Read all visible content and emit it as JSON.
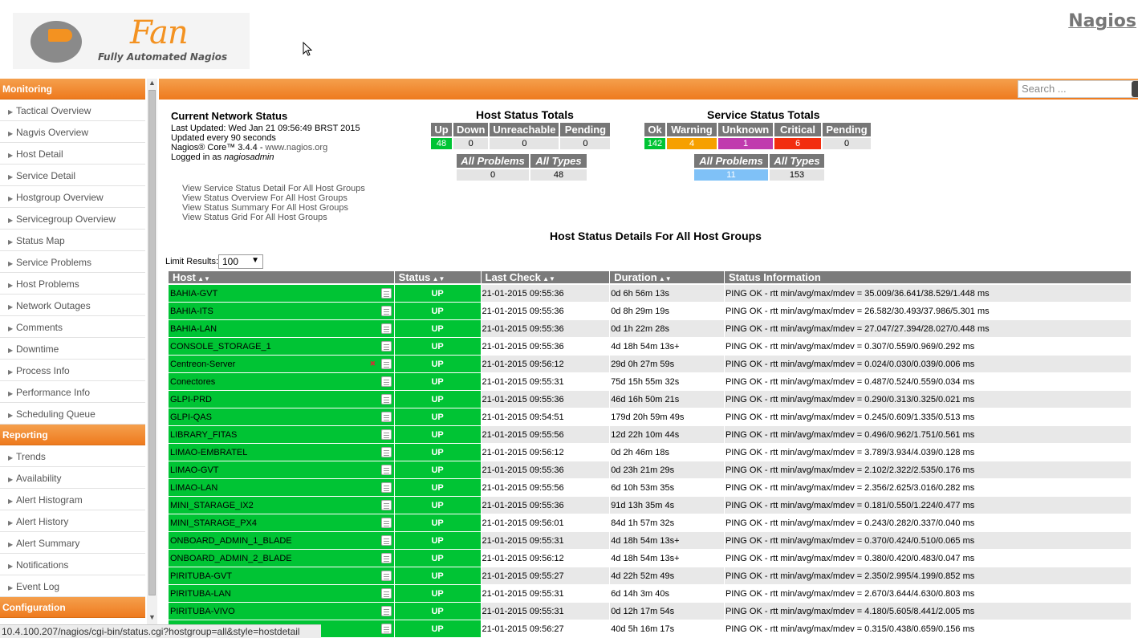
{
  "header": {
    "logo_text": "Fan",
    "logo_subtitle": "Fully Automated Nagios",
    "brand": "Nagios"
  },
  "search": {
    "placeholder": "Search ..."
  },
  "sidebar": {
    "sections": [
      {
        "title": "Monitoring",
        "items": [
          "Tactical Overview",
          "Nagvis Overview",
          "Host Detail",
          "Service Detail",
          "Hostgroup Overview",
          "Servicegroup Overview",
          "Status Map",
          "Service Problems",
          "Host Problems",
          "Network Outages",
          "Comments",
          "Downtime",
          "Process Info",
          "Performance Info",
          "Scheduling Queue"
        ]
      },
      {
        "title": "Reporting",
        "items": [
          "Trends",
          "Availability",
          "Alert Histogram",
          "Alert History",
          "Alert Summary",
          "Notifications",
          "Event Log"
        ]
      },
      {
        "title": "Configuration",
        "items": []
      }
    ]
  },
  "status": {
    "title": "Current Network Status",
    "last_updated": "Last Updated: Wed Jan 21 09:56:49 BRST 2015",
    "update_interval": "Updated every 90 seconds",
    "version_prefix": "Nagios® Core™ 3.4.4 - ",
    "version_link": "www.nagios.org",
    "logged_prefix": "Logged in as ",
    "user": "nagiosadmin"
  },
  "host_totals": {
    "title": "Host Status Totals",
    "headers": [
      "Up",
      "Down",
      "Unreachable",
      "Pending"
    ],
    "values": [
      "48",
      "0",
      "0",
      "0"
    ],
    "colors": [
      "#00c434",
      "#e4e4e4",
      "#e4e4e4",
      "#e4e4e4"
    ],
    "sum_headers": [
      "All Problems",
      "All Types"
    ],
    "sum_values": [
      "0",
      "48"
    ]
  },
  "service_totals": {
    "title": "Service Status Totals",
    "headers": [
      "Ok",
      "Warning",
      "Unknown",
      "Critical",
      "Pending"
    ],
    "values": [
      "142",
      "4",
      "1",
      "6",
      "0"
    ],
    "colors": [
      "#00c434",
      "#f6a000",
      "#c03aae",
      "#f22e0f",
      "#e4e4e4"
    ],
    "sum_headers": [
      "All Problems",
      "All Types"
    ],
    "sum_values": [
      "11",
      "153"
    ],
    "sum_colors": [
      "#7fc1f7",
      "#e4e4e4"
    ]
  },
  "links": [
    "View Service Status Detail For All Host Groups",
    "View Status Overview For All Host Groups",
    "View Status Summary For All Host Groups",
    "View Status Grid For All Host Groups"
  ],
  "host_details": {
    "title": "Host Status Details For All Host Groups",
    "limit_label": "Limit Results:",
    "limit_value": "100",
    "columns": [
      "Host",
      "Status",
      "Last Check",
      "Duration",
      "Status Information"
    ],
    "rows": [
      [
        "BAHIA-GVT",
        "UP",
        "21-01-2015 09:55:36",
        "0d 6h 56m 13s",
        "PING OK - rtt min/avg/max/mdev = 35.009/36.641/38.529/1.448 ms"
      ],
      [
        "BAHIA-ITS",
        "UP",
        "21-01-2015 09:55:36",
        "0d 8h 29m 19s",
        "PING OK - rtt min/avg/max/mdev = 26.582/30.493/37.986/5.301 ms"
      ],
      [
        "BAHIA-LAN",
        "UP",
        "21-01-2015 09:55:36",
        "0d 1h 22m 28s",
        "PING OK - rtt min/avg/max/mdev = 27.047/27.394/28.027/0.448 ms"
      ],
      [
        "CONSOLE_STORAGE_1",
        "UP",
        "21-01-2015 09:55:36",
        "4d 18h 54m 13s+",
        "PING OK - rtt min/avg/max/mdev = 0.307/0.559/0.969/0.292 ms"
      ],
      [
        "Centreon-Server",
        "UP",
        "21-01-2015 09:56:12",
        "29d 0h 27m 59s",
        "PING OK - rtt min/avg/max/mdev = 0.024/0.030/0.039/0.006 ms"
      ],
      [
        "Conectores",
        "UP",
        "21-01-2015 09:55:31",
        "75d 15h 55m 32s",
        "PING OK - rtt min/avg/max/mdev = 0.487/0.524/0.559/0.034 ms"
      ],
      [
        "GLPI-PRD",
        "UP",
        "21-01-2015 09:55:36",
        "46d 16h 50m 21s",
        "PING OK - rtt min/avg/max/mdev = 0.290/0.313/0.325/0.021 ms"
      ],
      [
        "GLPI-QAS",
        "UP",
        "21-01-2015 09:54:51",
        "179d 20h 59m 49s",
        "PING OK - rtt min/avg/max/mdev = 0.245/0.609/1.335/0.513 ms"
      ],
      [
        "LIBRARY_FITAS",
        "UP",
        "21-01-2015 09:55:56",
        "12d 22h 10m 44s",
        "PING OK - rtt min/avg/max/mdev = 0.496/0.962/1.751/0.561 ms"
      ],
      [
        "LIMAO-EMBRATEL",
        "UP",
        "21-01-2015 09:56:12",
        "0d 2h 46m 18s",
        "PING OK - rtt min/avg/max/mdev = 3.789/3.934/4.039/0.128 ms"
      ],
      [
        "LIMAO-GVT",
        "UP",
        "21-01-2015 09:55:36",
        "0d 23h 21m 29s",
        "PING OK - rtt min/avg/max/mdev = 2.102/2.322/2.535/0.176 ms"
      ],
      [
        "LIMAO-LAN",
        "UP",
        "21-01-2015 09:55:56",
        "6d 10h 53m 35s",
        "PING OK - rtt min/avg/max/mdev = 2.356/2.625/3.016/0.282 ms"
      ],
      [
        "MINI_STARAGE_IX2",
        "UP",
        "21-01-2015 09:55:36",
        "91d 13h 35m 4s",
        "PING OK - rtt min/avg/max/mdev = 0.181/0.550/1.224/0.477 ms"
      ],
      [
        "MINI_STARAGE_PX4",
        "UP",
        "21-01-2015 09:56:01",
        "84d 1h 57m 32s",
        "PING OK - rtt min/avg/max/mdev = 0.243/0.282/0.337/0.040 ms"
      ],
      [
        "ONBOARD_ADMIN_1_BLADE",
        "UP",
        "21-01-2015 09:55:31",
        "4d 18h 54m 13s+",
        "PING OK - rtt min/avg/max/mdev = 0.370/0.424/0.510/0.065 ms"
      ],
      [
        "ONBOARD_ADMIN_2_BLADE",
        "UP",
        "21-01-2015 09:56:12",
        "4d 18h 54m 13s+",
        "PING OK - rtt min/avg/max/mdev = 0.380/0.420/0.483/0.047 ms"
      ],
      [
        "PIRITUBA-GVT",
        "UP",
        "21-01-2015 09:55:27",
        "4d 22h 52m 49s",
        "PING OK - rtt min/avg/max/mdev = 2.350/2.995/4.199/0.852 ms"
      ],
      [
        "PIRITUBA-LAN",
        "UP",
        "21-01-2015 09:55:31",
        "6d 14h 3m 40s",
        "PING OK - rtt min/avg/max/mdev = 2.670/3.644/4.630/0.803 ms"
      ],
      [
        "PIRITUBA-VIVO",
        "UP",
        "21-01-2015 09:55:31",
        "0d 12h 17m 54s",
        "PING OK - rtt min/avg/max/mdev = 4.180/5.605/8.441/2.005 ms"
      ],
      [
        "",
        "UP",
        "21-01-2015 09:56:27",
        "40d 5h 16m 17s",
        "PING OK - rtt min/avg/max/mdev = 0.315/0.438/0.659/0.156 ms"
      ]
    ]
  },
  "statusbar": "10.4.100.207/nagios/cgi-bin/status.cgi?hostgroup=all&style=hostdetail"
}
